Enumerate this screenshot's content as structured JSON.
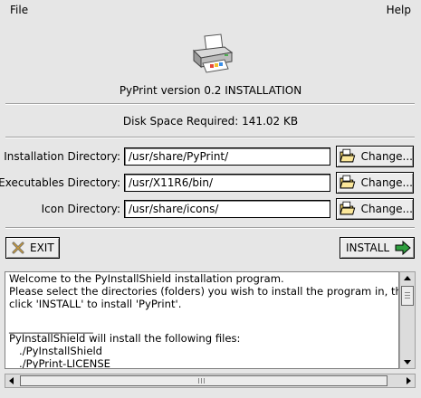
{
  "menu": {
    "file": "File",
    "help": "Help"
  },
  "header": {
    "title": "PyPrint version 0.2 INSTALLATION",
    "disk_space": "Disk Space Required: 141.02 KB"
  },
  "fields": [
    {
      "label": "Installation Directory:",
      "value": "/usr/share/PyPrint/",
      "button": "Change..."
    },
    {
      "label": "Executables Directory:",
      "value": "/usr/X11R6/bin/",
      "button": "Change..."
    },
    {
      "label": "Icon Directory:",
      "value": "/usr/share/icons/",
      "button": "Change..."
    }
  ],
  "actions": {
    "exit": "EXIT",
    "install": "INSTALL"
  },
  "info_text": {
    "lines": [
      "Welcome to the PyInstallShield installation program.",
      "Please select the directories (folders) you wish to install the program in, then",
      "click 'INSTALL' to install 'PyPrint'.",
      "",
      "________________",
      "PyInstallShield will install the following files:",
      "   ./PyInstallShield",
      "   ./PyPrint-LICENSE"
    ]
  },
  "icons": {
    "header": "printer-icon",
    "change": "folder-open-icon",
    "exit": "close-x-icon",
    "install": "arrow-right-icon"
  }
}
